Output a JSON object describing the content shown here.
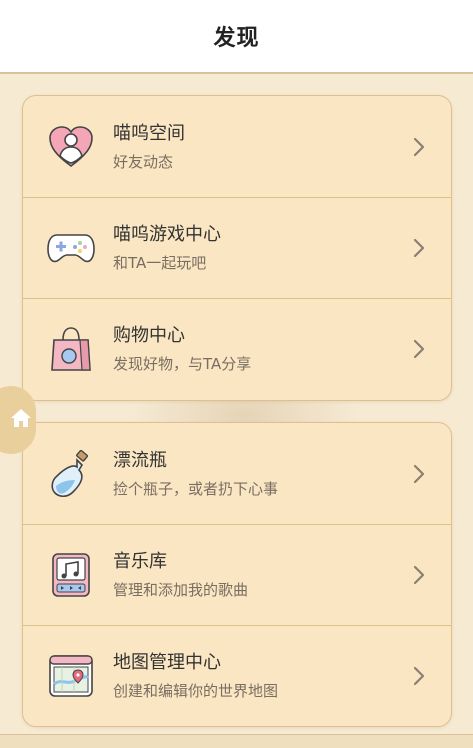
{
  "header": {
    "title": "发现"
  },
  "groups": [
    {
      "items": [
        {
          "icon": "heart-user-icon",
          "title": "喵呜空间",
          "subtitle": "好友动态"
        },
        {
          "icon": "gamepad-icon",
          "title": "喵呜游戏中心",
          "subtitle": "和TA一起玩吧"
        },
        {
          "icon": "shopping-bag-icon",
          "title": "购物中心",
          "subtitle": "发现好物，与TA分享"
        }
      ]
    },
    {
      "items": [
        {
          "icon": "bottle-icon",
          "title": "漂流瓶",
          "subtitle": "捡个瓶子，或者扔下心事"
        },
        {
          "icon": "music-player-icon",
          "title": "音乐库",
          "subtitle": "管理和添加我的歌曲"
        },
        {
          "icon": "map-icon",
          "title": "地图管理中心",
          "subtitle": "创建和编辑你的世界地图"
        }
      ]
    }
  ],
  "floating": {
    "icon": "home-icon"
  },
  "colors": {
    "card": "#fae6c2",
    "border": "#dcc18f",
    "background": "#f6ead3",
    "accent": "#e8cf9c"
  }
}
